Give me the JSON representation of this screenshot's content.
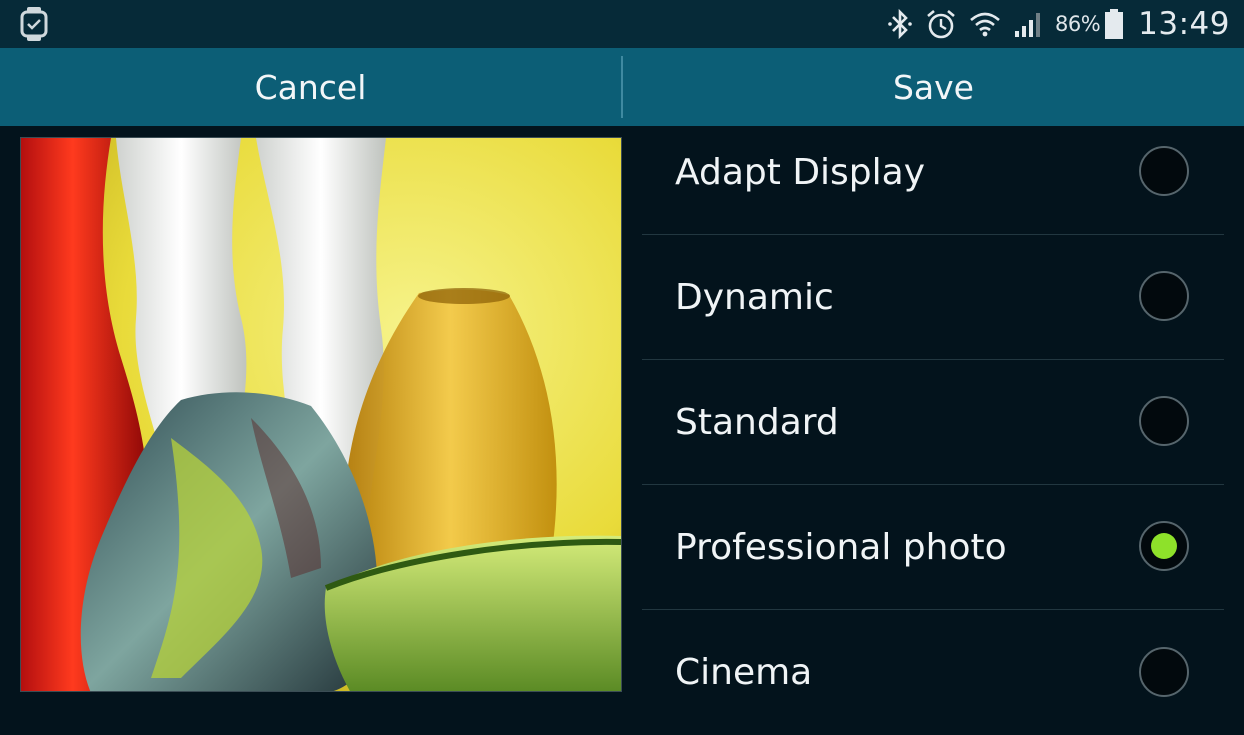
{
  "status_bar": {
    "battery_percent": "86%",
    "time": "13:49",
    "left_icon": "smartwatch-icon",
    "icons": [
      "bluetooth-icon",
      "alarm-icon",
      "wifi-icon",
      "signal-icon",
      "battery-icon"
    ]
  },
  "action_bar": {
    "cancel_label": "Cancel",
    "save_label": "Save"
  },
  "modes": [
    {
      "label": "Adapt Display",
      "selected": false
    },
    {
      "label": "Dynamic",
      "selected": false
    },
    {
      "label": "Standard",
      "selected": false
    },
    {
      "label": "Professional photo",
      "selected": true
    },
    {
      "label": "Cinema",
      "selected": false
    }
  ],
  "colors": {
    "action_bar": "#0c5e76",
    "status_bar": "#062a38",
    "background": "#03131c",
    "radio_selected": "#8ee12a"
  }
}
